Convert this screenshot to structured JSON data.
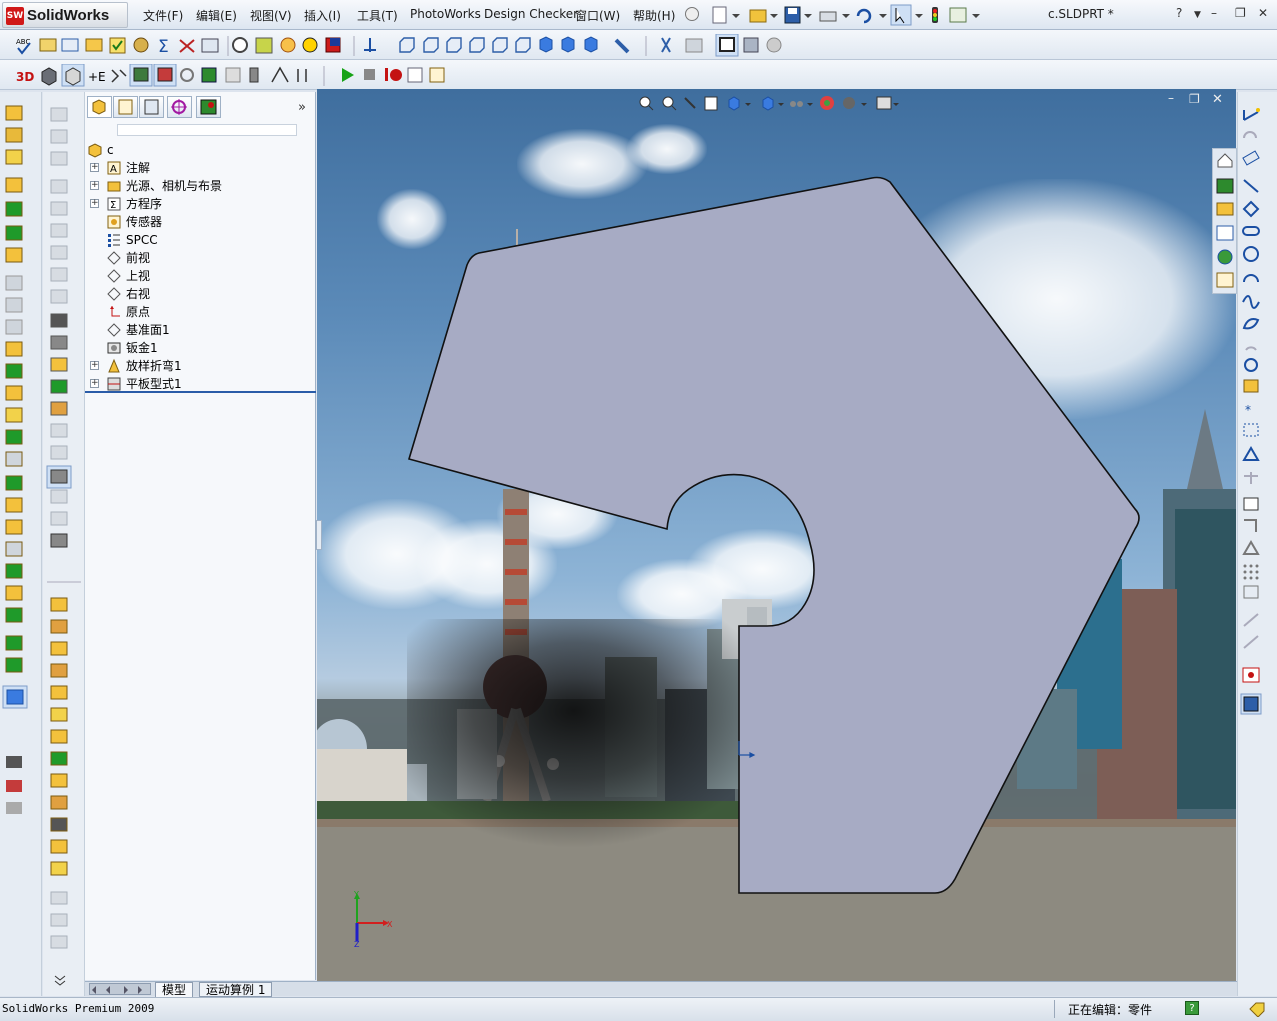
{
  "app": {
    "logo_text": "SolidWorks",
    "document_title": "c.SLDPRT *"
  },
  "menu": {
    "items": [
      "文件(F)",
      "编辑(E)",
      "视图(V)",
      "插入(I)",
      "工具(T)",
      "PhotoWorks",
      "Design Checker",
      "窗口(W)",
      "帮助(H)"
    ]
  },
  "window_controls": {
    "help": "?",
    "minimize": "–",
    "restore": "❐",
    "close": "✕"
  },
  "feature_tree": {
    "root": "c",
    "items": [
      {
        "label": "注解",
        "expandable": true,
        "icon": "annotation-icon"
      },
      {
        "label": "光源、相机与布景",
        "expandable": true,
        "icon": "lights-icon"
      },
      {
        "label": "方程序",
        "expandable": true,
        "icon": "equation-icon"
      },
      {
        "label": "传感器",
        "expandable": false,
        "icon": "sensor-icon"
      },
      {
        "label": "SPCC",
        "expandable": false,
        "icon": "material-icon"
      },
      {
        "label": "前视",
        "expandable": false,
        "icon": "plane-icon"
      },
      {
        "label": "上视",
        "expandable": false,
        "icon": "plane-icon"
      },
      {
        "label": "右视",
        "expandable": false,
        "icon": "plane-icon"
      },
      {
        "label": "原点",
        "expandable": false,
        "icon": "origin-icon"
      },
      {
        "label": "基准面1",
        "expandable": false,
        "icon": "plane-icon"
      },
      {
        "label": "钣金1",
        "expandable": false,
        "icon": "sheetmetal-icon"
      },
      {
        "label": "放样折弯1",
        "expandable": true,
        "icon": "lofted-bend-icon"
      },
      {
        "label": "平板型式1",
        "expandable": true,
        "icon": "flat-pattern-icon"
      }
    ]
  },
  "bottom_tabs": [
    "模型",
    "运动算例 1"
  ],
  "status": {
    "product": "SolidWorks Premium 2009",
    "editing": "正在编辑：零件",
    "help_badge": "?"
  },
  "triad": {
    "x_label": "X",
    "y_label": "Y",
    "z_label": "Z"
  },
  "colors": {
    "part_face": "#a7abc4",
    "selection_blue": "#2a5ca8",
    "logo_red": "#c41212"
  }
}
